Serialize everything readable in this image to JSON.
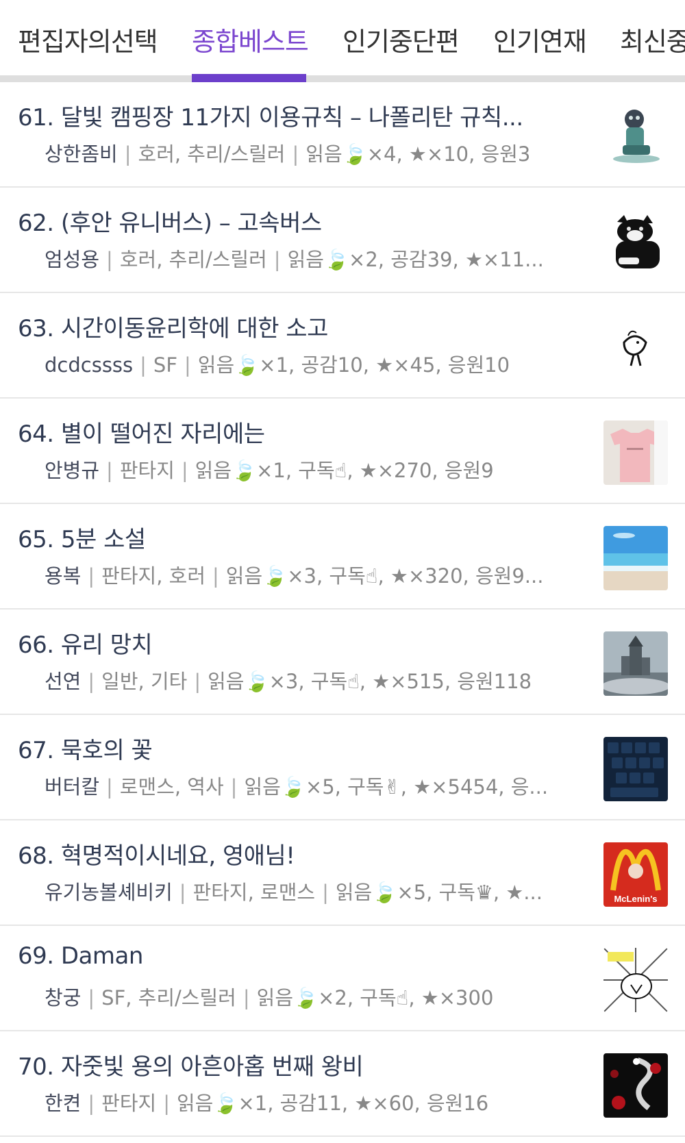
{
  "tabs": [
    {
      "label": "편집자의선택",
      "active": false
    },
    {
      "label": "종합베스트",
      "active": true
    },
    {
      "label": "인기중단편",
      "active": false
    },
    {
      "label": "인기연재",
      "active": false
    },
    {
      "label": "최신중",
      "active": false
    }
  ],
  "colors": {
    "accent": "#6c3fcb",
    "title": "#2f3a52",
    "meta": "#888888"
  },
  "items": [
    {
      "title": "61. 달빛 캠핑장 11가지 이용규칙 – 나폴리탄 규칙...",
      "author": "상한좀비",
      "genre": "호러, 추리/스릴러",
      "stats": "읽음🍃×4, ★×10, 응원3",
      "thumb": "zombie-figure"
    },
    {
      "title": "62. (후안 유니버스) – 고속버스",
      "author": "엄성용",
      "genre": "호러, 추리/스릴러",
      "stats": "읽음🍃×2, 공감39, ★×11...",
      "thumb": "black-cat"
    },
    {
      "title": "63. 시간이동윤리학에 대한 소고",
      "author": "dcdcssss",
      "genre": "SF",
      "stats": "읽음🍃×1, 공감10, ★×45, 응원10",
      "thumb": "bird-doodle"
    },
    {
      "title": "64. 별이 떨어진 자리에는",
      "author": "안병규",
      "genre": "판타지",
      "stats": "읽음🍃×1, 구독☝, ★×270, 응원9",
      "thumb": "pink-shirt"
    },
    {
      "title": "65. 5분 소설",
      "author": "용복",
      "genre": "판타지, 호러",
      "stats": "읽음🍃×3, 구독☝, ★×320, 응원9...",
      "thumb": "beach"
    },
    {
      "title": "66. 유리 망치",
      "author": "선연",
      "genre": "일반, 기타",
      "stats": "읽음🍃×3, 구독☝, ★×515, 응원118",
      "thumb": "castle"
    },
    {
      "title": "67. 묵호의 꽃",
      "author": "버터칼",
      "genre": "로맨스, 역사",
      "stats": "읽음🍃×5, 구독✌, ★×5454, 응...",
      "thumb": "keyboard"
    },
    {
      "title": "68. 혁명적이시네요, 영애님!",
      "author": "유기농볼셰비키",
      "genre": "판타지, 로맨스",
      "stats": "읽음🍃×5, 구독♛, ★...",
      "thumb": "mclenins",
      "thumb_text": "McLenin's"
    },
    {
      "title": "69. Daman",
      "author": "창궁",
      "genre": "SF, 추리/스릴러",
      "stats": "읽음🍃×2, 구독☝, ★×300",
      "thumb": "comic-burst"
    },
    {
      "title": "70. 자줏빛 용의 아흔아홉 번째 왕비",
      "author": "한켠",
      "genre": "판타지",
      "stats": "읽음🍃×1, 공감11, ★×60, 응원16",
      "thumb": "dragon-roses"
    }
  ]
}
